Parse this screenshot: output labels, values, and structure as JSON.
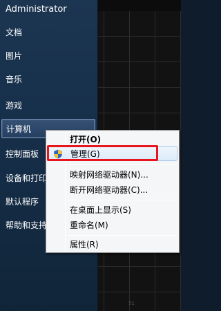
{
  "start_menu": {
    "user_name": "Administrator",
    "items": [
      {
        "label": "文档"
      },
      {
        "label": "图片"
      },
      {
        "label": "音乐"
      },
      {
        "label": "游戏"
      },
      {
        "label": "计算机"
      },
      {
        "label": "控制面板"
      },
      {
        "label": "设备和打印"
      },
      {
        "label": "默认程序"
      },
      {
        "label": "帮助和支持"
      }
    ]
  },
  "context_menu": {
    "items": [
      {
        "label": "打开(O)"
      },
      {
        "label": "管理(G)"
      },
      {
        "label": "映射网络驱动器(N)..."
      },
      {
        "label": "断开网络驱动器(C)..."
      },
      {
        "label": "在桌面上显示(S)"
      },
      {
        "label": "重命名(M)"
      },
      {
        "label": "属性(R)"
      }
    ]
  },
  "grid_footer_text": "51",
  "colors": {
    "highlight_box": "#e8141e",
    "menu_selected_bg": "#dcebfa",
    "panel_bg": "#17304b"
  },
  "icons": {
    "manage_item_icon": "uac-shield-icon"
  }
}
